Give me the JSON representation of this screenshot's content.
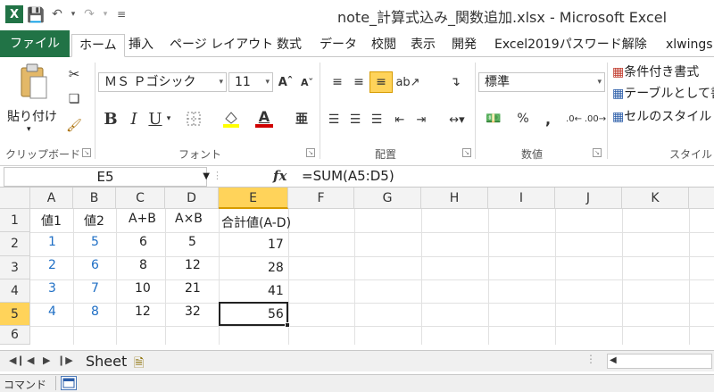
{
  "window": {
    "title": "note_計算式込み_関数追加.xlsx - Microsoft Excel"
  },
  "ribbon_tabs": [
    {
      "label": "ファイル"
    },
    {
      "label": "ホーム"
    },
    {
      "label": "挿入"
    },
    {
      "label": "ページ レイアウト"
    },
    {
      "label": "数式"
    },
    {
      "label": "データ"
    },
    {
      "label": "校閲"
    },
    {
      "label": "表示"
    },
    {
      "label": "開発"
    },
    {
      "label": "Excel2019パスワード解除"
    },
    {
      "label": "xlwings"
    }
  ],
  "clipboard": {
    "paste_label": "貼り付け",
    "group_label": "クリップボード"
  },
  "font": {
    "name": "ＭＳ Ｐゴシック",
    "size": "11",
    "group_label": "フォント",
    "bold": "B",
    "italic": "I",
    "underline": "U",
    "font_color_letter": "A",
    "highlight_color": "#ffff00",
    "font_color": "#d00000"
  },
  "alignment": {
    "group_label": "配置"
  },
  "number": {
    "format": "標準",
    "group_label": "数値",
    "percent": "%",
    "comma": ","
  },
  "styles": {
    "conditional": "条件付き書式",
    "table": "テーブルとして書",
    "cell_style": "セルのスタイル",
    "group_label": "スタイル"
  },
  "formula_bar": {
    "name_box": "E5",
    "fx": "fx",
    "formula": "=SUM(A5:D5)"
  },
  "columns": [
    "A",
    "B",
    "C",
    "D",
    "E",
    "F",
    "G",
    "H",
    "I",
    "J",
    "K"
  ],
  "rows": [
    "1",
    "2",
    "3",
    "4",
    "5",
    "6"
  ],
  "cells": {
    "A1": "値1",
    "B1": "値2",
    "C1": "A+B",
    "D1": "A×B",
    "E1": "合計値(A-D)",
    "A2": "1",
    "B2": "5",
    "C2": "6",
    "D2": "5",
    "E2": "17",
    "A3": "2",
    "B3": "6",
    "C3": "8",
    "D3": "12",
    "E3": "28",
    "A4": "3",
    "B4": "7",
    "C4": "10",
    "D4": "21",
    "E4": "41",
    "A5": "4",
    "B5": "8",
    "C5": "12",
    "D5": "32",
    "E5": "56"
  },
  "sheet": {
    "tab_label": "Sheet"
  },
  "status": {
    "text": "コマンド"
  },
  "colors": {
    "file_tab": "#217346",
    "selection_header": "#ffd35a",
    "input_value": "#1f6fc5"
  }
}
